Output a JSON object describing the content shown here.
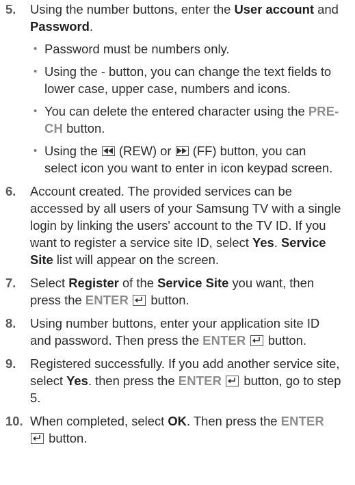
{
  "steps": [
    {
      "number": "5.",
      "t1": "Using the number buttons, enter the ",
      "b1": "User account",
      "t2": " and ",
      "b2": "Password",
      "t3": ".",
      "bullets": {
        "b1": "Password must be numbers only.",
        "b2": "Using the - button, you can change the text fields to lower case, upper case, numbers and icons.",
        "b3_pre": "You can delete the entered character using the ",
        "b3_key": "PRE-CH",
        "b3_post": " button.",
        "b4_pre": "Using the ",
        "b4_rew": " (REW) or ",
        "b4_ff": " (FF) button, you can select icon you want to enter in icon keypad screen."
      }
    },
    {
      "number": "6.",
      "t1": "Account created. The provided services can be accessed by all users of your Samsung TV with a single login by linking the users' account to the TV ID. If you want to register a service site ID, select ",
      "b1": "Yes",
      "t2": ". ",
      "b2": "Service Site",
      "t3": " list will appear on the screen."
    },
    {
      "number": "7.",
      "t1": "Select ",
      "b1": "Register",
      "t2": " of the ",
      "b2": "Service Site",
      "t3": " you want, then press the ",
      "key": "ENTER",
      "t4": " button."
    },
    {
      "number": "8.",
      "t1": "Using number buttons, enter your application site ID and password. Then press the ",
      "key": "ENTER",
      "t2": " button."
    },
    {
      "number": "9.",
      "t1": "Registered successfully. If you add another service site, select ",
      "b1": "Yes",
      "t2": ". then press the ",
      "key": "ENTER",
      "t3": " button, go to step 5."
    },
    {
      "number": "10.",
      "t1": "When completed, select ",
      "b1": "OK",
      "t2": ". Then press the ",
      "key": "ENTER",
      "t3": " button."
    }
  ],
  "icons": {
    "rew": "rewind-icon",
    "ff": "fast-forward-icon",
    "enter": "enter-icon"
  }
}
